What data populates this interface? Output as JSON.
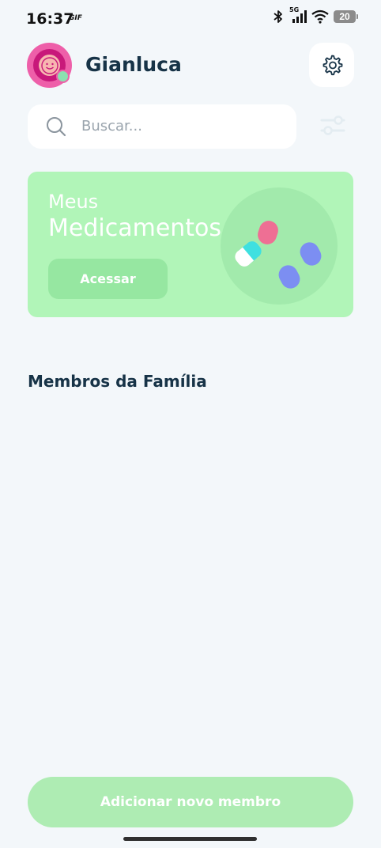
{
  "status_bar": {
    "time": "16:37",
    "gif_label": "GIF",
    "network": "5G",
    "battery": "20",
    "icons": [
      "bluetooth-icon",
      "signal-icon",
      "wifi-icon",
      "battery-icon"
    ]
  },
  "header": {
    "username": "Gianluca",
    "avatar_icon": "smiley-avatar-icon",
    "settings_icon": "gear-icon"
  },
  "search": {
    "placeholder": "Buscar...",
    "icon": "search-icon",
    "filter_icon": "filter-sliders-icon"
  },
  "medications_card": {
    "line1": "Meus",
    "line2": "Medicamentos",
    "button_label": "Acessar",
    "illustration": "pills-illustration"
  },
  "family": {
    "section_title": "Membros da Família"
  },
  "footer": {
    "add_member_label": "Adicionar novo membro"
  },
  "colors": {
    "background": "#f3f7fa",
    "card_green": "#b1f5b8",
    "button_green": "#96e7a1",
    "primary_text": "#173347",
    "avatar_pink": "#ee5fa9"
  }
}
